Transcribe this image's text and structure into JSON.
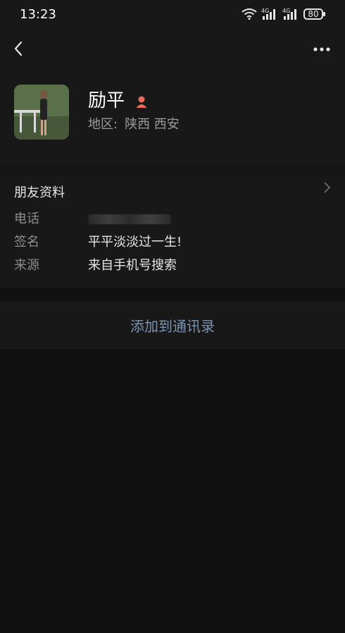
{
  "status_bar": {
    "time": "13:23",
    "battery": "80",
    "signal1": "4G",
    "signal2": "4G"
  },
  "profile": {
    "name": "励平",
    "region_label": "地区:",
    "region_value": "陕西  西安",
    "gender": "female"
  },
  "info": {
    "title": "朋友资料",
    "rows": [
      {
        "label": "电话",
        "value": ""
      },
      {
        "label": "签名",
        "value": "平平淡淡过一生!"
      },
      {
        "label": "来源",
        "value": "来自手机号搜索"
      }
    ]
  },
  "actions": {
    "add_label": "添加到通讯录"
  },
  "colors": {
    "accent": "#7d94b3",
    "gender": "#e86b5f"
  }
}
